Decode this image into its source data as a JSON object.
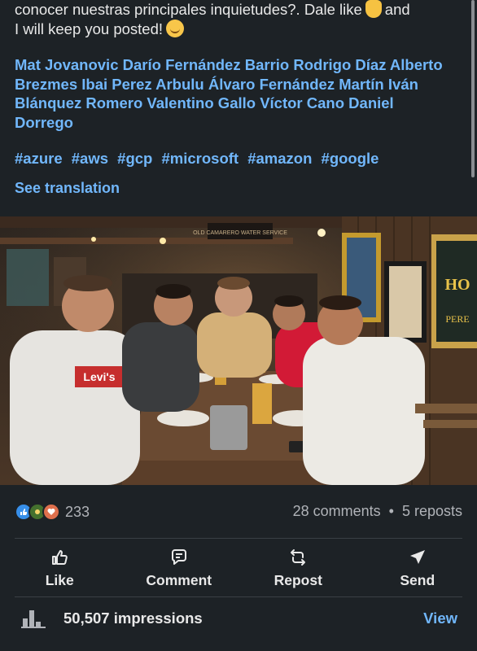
{
  "post": {
    "text_line1": "conocer nuestras principales inquietudes?. Dale like",
    "text_line1_end": "and",
    "text_line2": "I will keep you posted!",
    "thumbs_emoji": "👍",
    "smile_emoji": "😊",
    "mentions": [
      "Mat Jovanovic",
      "Darío Fernández Barrio",
      "Rodrigo Díaz Alberto Brezmes",
      "Ibai Perez Arbulu",
      "Álvaro Fernández Martín",
      "Iván Blánquez Romero",
      "Valentino Gallo",
      "Víctor Cano",
      "Daniel Dorrego"
    ],
    "hashtags": [
      "#azure",
      "#aws",
      "#gcp",
      "#microsoft",
      "#amazon",
      "#google"
    ],
    "see_translation": "See translation"
  },
  "photo": {
    "shirt_logo_text": "Levi's",
    "chalkboard_text": "HO",
    "chalkboard_text2": "PERE",
    "sign_text": "OLD CAMARERO WATER SERVICE"
  },
  "social": {
    "reaction_count": "233",
    "comments": "28 comments",
    "separator": "•",
    "reposts": "5 reposts",
    "reaction_colors": [
      "#378fe9",
      "#44712e",
      "#df704d"
    ]
  },
  "actions": {
    "like": "Like",
    "comment": "Comment",
    "repost": "Repost",
    "send": "Send"
  },
  "footer": {
    "impressions": "50,507 impressions",
    "view": "View"
  },
  "colors": {
    "background": "#1d2226",
    "link": "#71b7fb",
    "text": "#e9e9e9",
    "muted": "#b0b3b8"
  }
}
